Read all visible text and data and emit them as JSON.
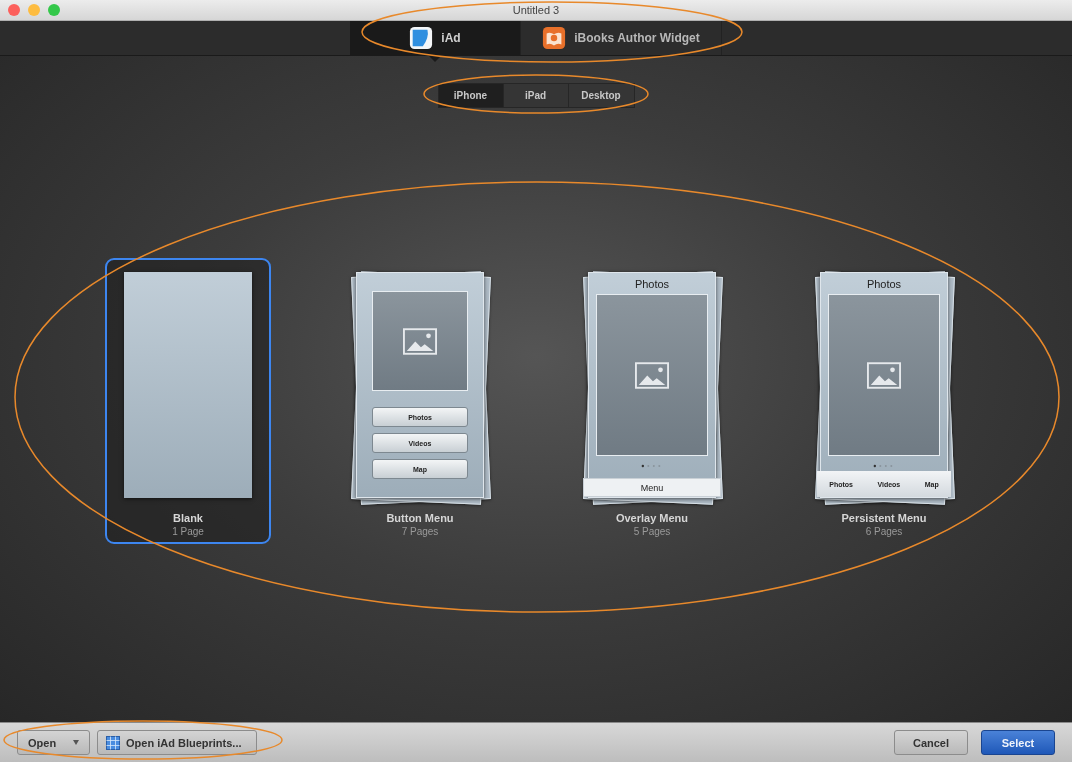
{
  "window": {
    "title": "Untitled 3"
  },
  "tabs": [
    {
      "kind": "iad",
      "label": "iAd",
      "selected": true
    },
    {
      "kind": "ibooks",
      "label": "iBooks Author Widget",
      "selected": false
    }
  ],
  "devices": [
    {
      "label": "iPhone",
      "selected": true
    },
    {
      "label": "iPad",
      "selected": false
    },
    {
      "label": "Desktop",
      "selected": false
    }
  ],
  "templates": [
    {
      "kind": "blank",
      "name": "Blank",
      "pages": "1 Page",
      "selected": true
    },
    {
      "kind": "buttons",
      "name": "Button Menu",
      "pages": "7 Pages",
      "selected": false,
      "buttons": [
        "Photos",
        "Videos",
        "Map"
      ]
    },
    {
      "kind": "overlay",
      "name": "Overlay Menu",
      "pages": "5 Pages",
      "selected": false,
      "title": "Photos",
      "menu": "Menu"
    },
    {
      "kind": "persistent",
      "name": "Persistent Menu",
      "pages": "6 Pages",
      "selected": false,
      "title": "Photos",
      "tabs": [
        "Photos",
        "Videos",
        "Map"
      ]
    }
  ],
  "footer": {
    "open": "Open",
    "blueprints": "Open iAd Blueprints...",
    "cancel": "Cancel",
    "select": "Select"
  }
}
